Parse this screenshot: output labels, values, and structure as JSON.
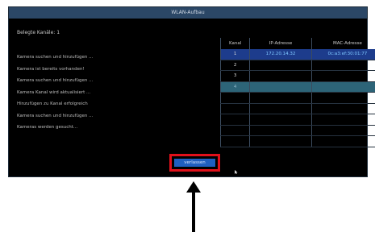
{
  "dialog": {
    "title": "WLAN-Aufbau",
    "channels_label": "Belegte Kanäle: 1"
  },
  "log": [
    "Kamera suchen und hinzufügen ...",
    "Kamera ist bereits vorhanden!",
    "Kamera suchen und hinzufügen ...",
    "Kamera Kanal wird aktualisiert ...",
    "Hinzufügen zu Kanal erfolgreich",
    "Kamera suchen und hinzufügen ...",
    "Kameras werden gesucht..."
  ],
  "table": {
    "headers": {
      "kanal": "Kanal",
      "ip": "IP-Adresse",
      "mac": "MAC-Adresse"
    },
    "rows": [
      {
        "kanal": "1",
        "ip": "172.20.14.32",
        "mac": "0c:a3:ef:30:01:77"
      },
      {
        "kanal": "2",
        "ip": "",
        "mac": ""
      },
      {
        "kanal": "3",
        "ip": "",
        "mac": ""
      },
      {
        "kanal": "4",
        "ip": "",
        "mac": ""
      },
      {
        "kanal": "",
        "ip": "",
        "mac": ""
      },
      {
        "kanal": "",
        "ip": "",
        "mac": ""
      },
      {
        "kanal": "",
        "ip": "",
        "mac": ""
      },
      {
        "kanal": "",
        "ip": "",
        "mac": ""
      },
      {
        "kanal": "",
        "ip": "",
        "mac": ""
      }
    ]
  },
  "button": {
    "label": "verlassen"
  },
  "icons": {
    "cursor": "mouse-pointer-icon",
    "arrow": "up-arrow-icon"
  },
  "colors": {
    "highlight": "#e0101a",
    "selected_row": "#1d3c8c",
    "focus_row": "#2d6478"
  }
}
